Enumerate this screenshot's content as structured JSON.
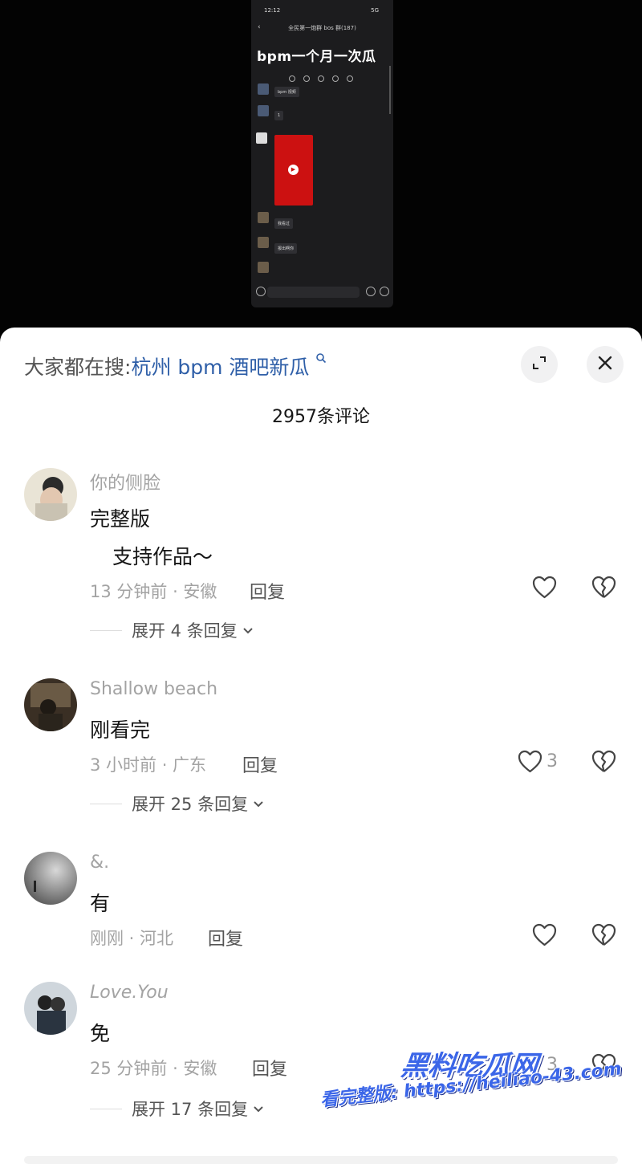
{
  "video": {
    "phone_time": "12:12",
    "phone_status": "5G",
    "phone_title": "全民第一炮群 bos 群(187)",
    "headline": "bpm一个月一次瓜",
    "bubble_1": "bpm 视频",
    "bubble_2": "1",
    "bubble_3": "我看过",
    "bubble_4": "报出啊你"
  },
  "sheet": {
    "search_prefix": "大家都在搜:",
    "search_keyword": "杭州 bpm 酒吧新瓜",
    "comment_count": "2957条评论"
  },
  "comments": [
    {
      "user": "你的侧脸",
      "text_line1": "完整版",
      "text_line2": "支持作品～",
      "meta": "13 分钟前 · 安徽",
      "reply": "回复",
      "likes": "",
      "expand": "展开 4 条回复"
    },
    {
      "user": "Shallow beach",
      "text_line1": "刚看完",
      "meta": "3 小时前 · 广东",
      "reply": "回复",
      "likes": "3",
      "expand": "展开 25 条回复"
    },
    {
      "user": "&.",
      "text_line1": "有",
      "meta": "刚刚 · 河北",
      "reply": "回复",
      "likes": ""
    },
    {
      "user": "Love.You",
      "text_line1": "免",
      "meta": "25 分钟前 · 安徽",
      "reply": "回复",
      "likes": "3",
      "expand": "展开 17 条回复"
    }
  ],
  "watermark": {
    "brand": "黑料吃瓜网",
    "url_line": "看完整版: https://heiliao-43.com"
  },
  "icons": {
    "search": "search-icon",
    "expand": "expand-icon",
    "close": "close-icon",
    "like": "heart-icon",
    "dislike": "broken-heart-icon",
    "chevron": "chevron-down-icon"
  },
  "colors": {
    "keyword": "#2f5fa8",
    "watermark": "#3b66e8",
    "muted": "#a3a3a3"
  }
}
